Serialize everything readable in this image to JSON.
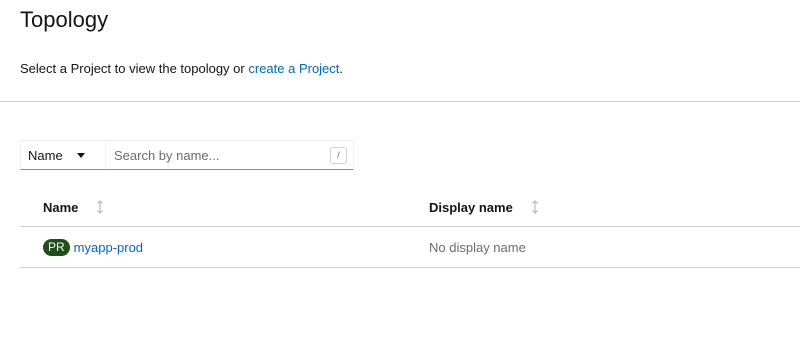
{
  "page": {
    "title": "Topology",
    "subtitle_text": "Select a Project to view the topology or ",
    "subtitle_link": "create a Project",
    "subtitle_suffix": "."
  },
  "filter": {
    "type_label": "Name",
    "placeholder": "Search by name...",
    "shortcut": "/"
  },
  "table": {
    "columns": [
      {
        "label": "Name"
      },
      {
        "label": "Display name"
      }
    ],
    "rows": [
      {
        "badge": "PR",
        "name": "myapp-prod",
        "display_name": "No display name"
      }
    ]
  },
  "colors": {
    "link": "#0066cc",
    "badge_bg": "#1e4f18",
    "divider": "#d2d2d2"
  }
}
